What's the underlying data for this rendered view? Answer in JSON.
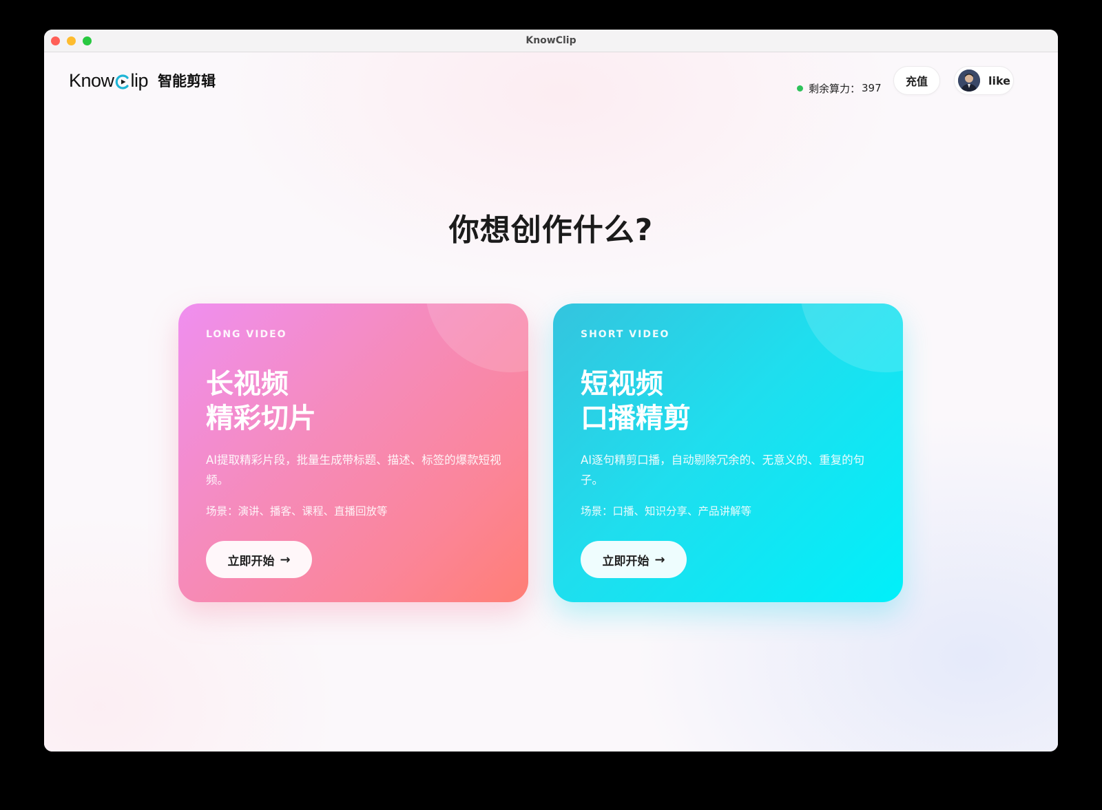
{
  "window": {
    "title": "KnowClip"
  },
  "header": {
    "logo_text_left": "Know",
    "logo_text_right": "lip",
    "logo_subtitle": "智能剪辑",
    "credits_label": "剩余算力：",
    "credits_value": "397",
    "recharge_label": "充值",
    "user_name": "like"
  },
  "main": {
    "heading": "你想创作什么?"
  },
  "cards": [
    {
      "tag": "LONG VIDEO",
      "title_line1": "长视频",
      "title_line2": "精彩切片",
      "description": "AI提取精彩片段，批量生成带标题、描述、标签的爆款短视频。",
      "scene": "场景：演讲、播客、课程、直播回放等",
      "cta_label": "立即开始",
      "cta_arrow": "→"
    },
    {
      "tag": "SHORT VIDEO",
      "title_line1": "短视频",
      "title_line2": "口播精剪",
      "description": "AI逐句精剪口播，自动剔除冗余的、无意义的、重复的句子。",
      "scene": "场景：口播、知识分享、产品讲解等",
      "cta_label": "立即开始",
      "cta_arrow": "→"
    }
  ],
  "colors": {
    "status_dot": "#2ec25a",
    "logo_accent": "#1fb5d6",
    "long_card_start": "#ef8ff0",
    "long_card_end": "#ff7e75",
    "short_card_start": "#34c4de",
    "short_card_end": "#00f0fa"
  }
}
